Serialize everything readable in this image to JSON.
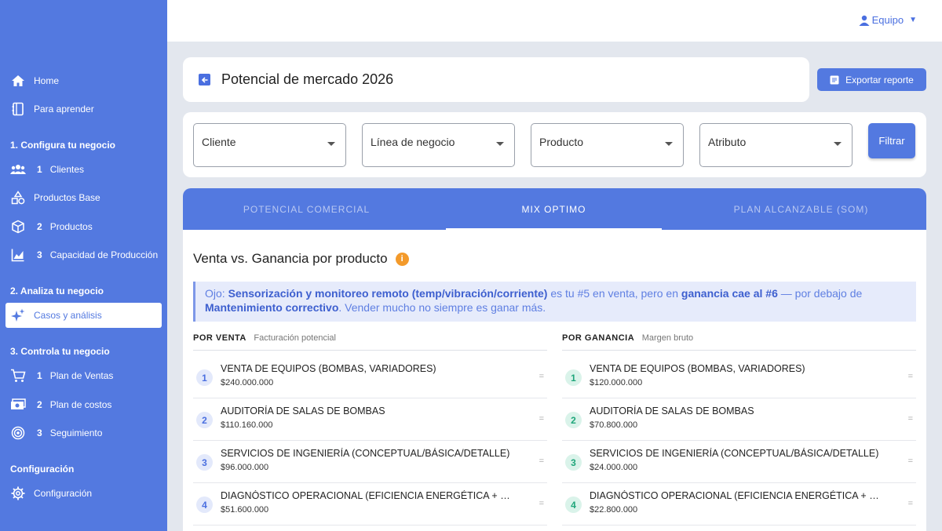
{
  "sidebar": {
    "items": [
      {
        "label": "Home",
        "icon": "home-icon"
      },
      {
        "label": "Para aprender",
        "icon": "book-icon"
      }
    ],
    "section1": "1. Configura tu negocio",
    "config_items": [
      {
        "num": "1",
        "label": "Clientes",
        "icon": "users-icon"
      },
      {
        "num": "",
        "label": "Productos Base",
        "icon": "shapes-icon"
      },
      {
        "num": "2",
        "label": "Productos",
        "icon": "cube-icon"
      },
      {
        "num": "3",
        "label": "Capacidad de Producción",
        "icon": "chart-area-icon"
      }
    ],
    "section2": "2. Analiza tu negocio",
    "analyze_item": {
      "label": "Casos y análisis",
      "icon": "sparkles-icon"
    },
    "section3": "3. Controla tu negocio",
    "control_items": [
      {
        "num": "1",
        "label": "Plan de Ventas",
        "icon": "cart-icon"
      },
      {
        "num": "2",
        "label": "Plan de costos",
        "icon": "money-icon"
      },
      {
        "num": "3",
        "label": "Seguimiento",
        "icon": "target-icon"
      }
    ],
    "section4": "Configuración",
    "settings_item": {
      "label": "Configuración",
      "icon": "gear-icon"
    }
  },
  "topbar": {
    "team_label": "Equipo"
  },
  "header": {
    "title": "Potencial de mercado 2026",
    "export_label": "Exportar reporte"
  },
  "filters": {
    "cliente": "Cliente",
    "linea": "Línea de negocio",
    "producto": "Producto",
    "atributo": "Atributo",
    "button": "Filtrar"
  },
  "tabs": [
    "POTENCIAL COMERCIAL",
    "MIX OPTIMO",
    "PLAN ALCANZABLE (SOM)"
  ],
  "active_tab": "MIX OPTIMO",
  "section": {
    "title": "Venta vs. Ganancia por producto",
    "info": "i"
  },
  "alert": {
    "p1": "Ojo: ",
    "b1": "Sensorización y monitoreo remoto (temp/vibración/corriente)",
    "p2": " es tu #5 en venta, pero en ",
    "b2": "ganancia cae al #6",
    "p3": " — por debajo de ",
    "b3": "Mantenimiento correctivo",
    "p4": ". Vender mucho no siempre es ganar más."
  },
  "por_venta": {
    "title": "POR VENTA",
    "subtitle": "Facturación potencial",
    "rows": [
      {
        "rank": "1",
        "name": "VENTA DE EQUIPOS (BOMBAS, VARIADORES)",
        "value": "$240.000.000"
      },
      {
        "rank": "2",
        "name": "AUDITORÍA DE SALAS DE BOMBAS",
        "value": "$110.160.000"
      },
      {
        "rank": "3",
        "name": "SERVICIOS DE INGENIERÍA (CONCEPTUAL/BÁSICA/DETALLE)",
        "value": "$96.000.000"
      },
      {
        "rank": "4",
        "name": "DIAGNÓSTICO OPERACIONAL (EFICIENCIA ENERGÉTICA + CONFIABILIDAD)",
        "value": "$51.600.000"
      }
    ]
  },
  "por_ganancia": {
    "title": "POR GANANCIA",
    "subtitle": "Margen bruto",
    "rows": [
      {
        "rank": "1",
        "name": "VENTA DE EQUIPOS (BOMBAS, VARIADORES)",
        "value": "$120.000.000"
      },
      {
        "rank": "2",
        "name": "AUDITORÍA DE SALAS DE BOMBAS",
        "value": "$70.800.000"
      },
      {
        "rank": "3",
        "name": "SERVICIOS DE INGENIERÍA (CONCEPTUAL/BÁSICA/DETALLE)",
        "value": "$24.000.000"
      },
      {
        "rank": "4",
        "name": "DIAGNÓSTICO OPERACIONAL (EFICIENCIA ENERGÉTICA + CONFIABILIDAD)",
        "value": "$22.800.000"
      }
    ]
  },
  "equal_marker": "=",
  "colors": {
    "primary": "#5379e0",
    "accent_orange": "#f39a2b",
    "rank_green": "#1fa67a"
  }
}
